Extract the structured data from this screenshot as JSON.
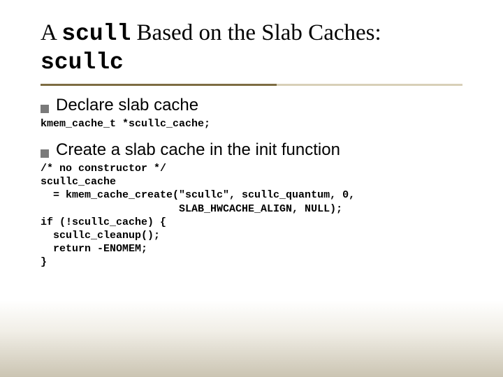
{
  "title": {
    "pre": "A ",
    "mono1": "scull",
    "mid": " Based on the Slab Caches: ",
    "mono2": "scullc"
  },
  "bullets": [
    {
      "text": "Declare slab cache"
    },
    {
      "text": "Create a slab cache in the init function"
    }
  ],
  "code": [
    "kmem_cache_t *scullc_cache;",
    "/* no constructor */\nscullc_cache\n  = kmem_cache_create(\"scullc\", scullc_quantum, 0,\n                      SLAB_HWCACHE_ALIGN, NULL);\nif (!scullc_cache) {\n  scullc_cleanup();\n  return -ENOMEM;\n}"
  ]
}
